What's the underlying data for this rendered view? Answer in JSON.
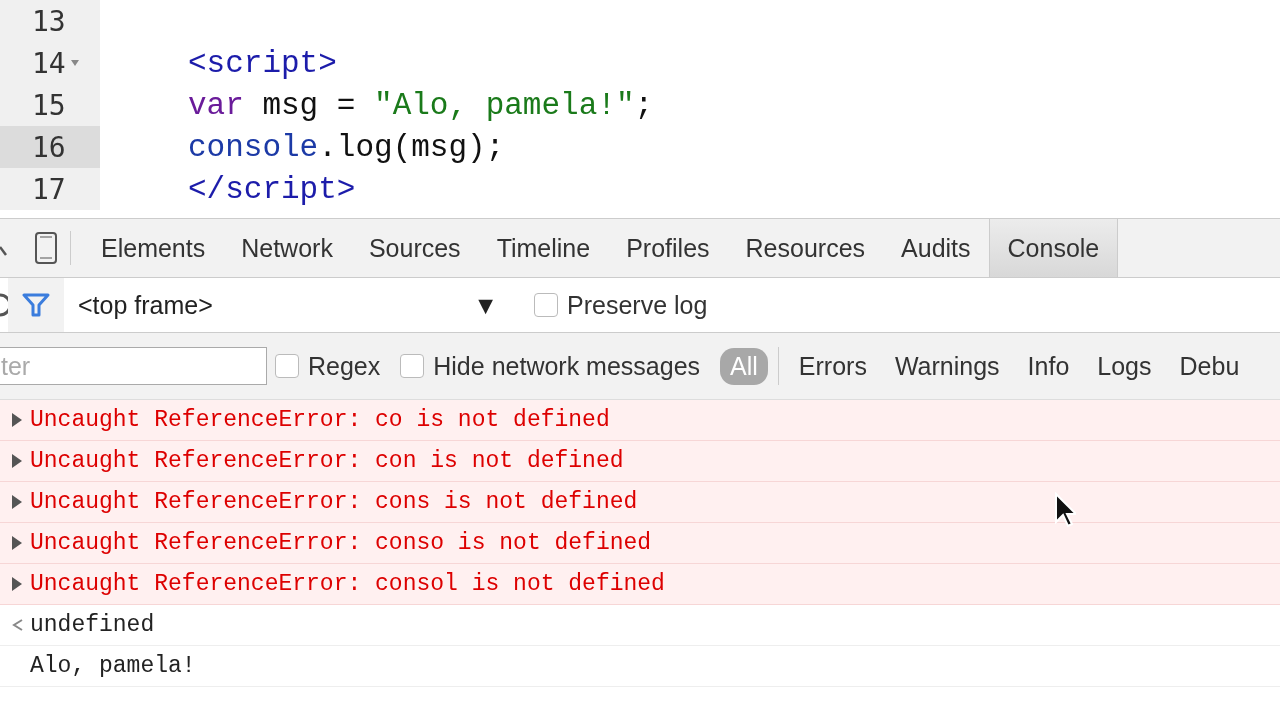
{
  "editor": {
    "lines": [
      {
        "number": "13",
        "fold": false,
        "highlighted": false
      },
      {
        "number": "14",
        "fold": true,
        "highlighted": false,
        "tokens": [
          {
            "text": "<script>",
            "kind": "tag"
          }
        ]
      },
      {
        "number": "15",
        "fold": false,
        "highlighted": false,
        "tokens": [
          {
            "text": "var",
            "kind": "keyword"
          },
          {
            "text": " msg = ",
            "kind": "plain"
          },
          {
            "text": "\"Alo, pamela!\"",
            "kind": "string"
          },
          {
            "text": ";",
            "kind": "plain"
          }
        ]
      },
      {
        "number": "16",
        "fold": false,
        "highlighted": true,
        "tokens": [
          {
            "text": "console",
            "kind": "name"
          },
          {
            "text": ".log(msg);",
            "kind": "plain"
          }
        ]
      },
      {
        "number": "17",
        "fold": false,
        "highlighted": false,
        "tokens": [
          {
            "text": "</script>",
            "kind": "tag"
          }
        ]
      }
    ]
  },
  "devtools": {
    "tabs": [
      {
        "label": "Elements",
        "selected": false
      },
      {
        "label": "Network",
        "selected": false
      },
      {
        "label": "Sources",
        "selected": false
      },
      {
        "label": "Timeline",
        "selected": false
      },
      {
        "label": "Profiles",
        "selected": false
      },
      {
        "label": "Resources",
        "selected": false
      },
      {
        "label": "Audits",
        "selected": false
      },
      {
        "label": "Console",
        "selected": true
      }
    ],
    "context": {
      "value": "<top frame>",
      "arrow": "▼"
    },
    "preserve_log": {
      "label": "Preserve log",
      "checked": false
    },
    "filter": {
      "placeholder": "ter"
    },
    "regex": {
      "label": "Regex",
      "checked": false
    },
    "hide_network": {
      "label": "Hide network messages",
      "checked": false
    },
    "levels": [
      {
        "label": "All",
        "selected": true
      },
      {
        "label": "Errors",
        "selected": false
      },
      {
        "label": "Warnings",
        "selected": false
      },
      {
        "label": "Info",
        "selected": false
      },
      {
        "label": "Logs",
        "selected": false
      },
      {
        "label": "Debu",
        "selected": false
      }
    ],
    "messages": [
      {
        "kind": "error",
        "text": "Uncaught ReferenceError: co is not defined"
      },
      {
        "kind": "error",
        "text": "Uncaught ReferenceError: con is not defined"
      },
      {
        "kind": "error",
        "text": "Uncaught ReferenceError: cons is not defined"
      },
      {
        "kind": "error",
        "text": "Uncaught ReferenceError: conso is not defined"
      },
      {
        "kind": "error",
        "text": "Uncaught ReferenceError: consol is not defined"
      },
      {
        "kind": "result",
        "text": "undefined"
      },
      {
        "kind": "log",
        "text": "Alo, pamela!"
      }
    ]
  }
}
